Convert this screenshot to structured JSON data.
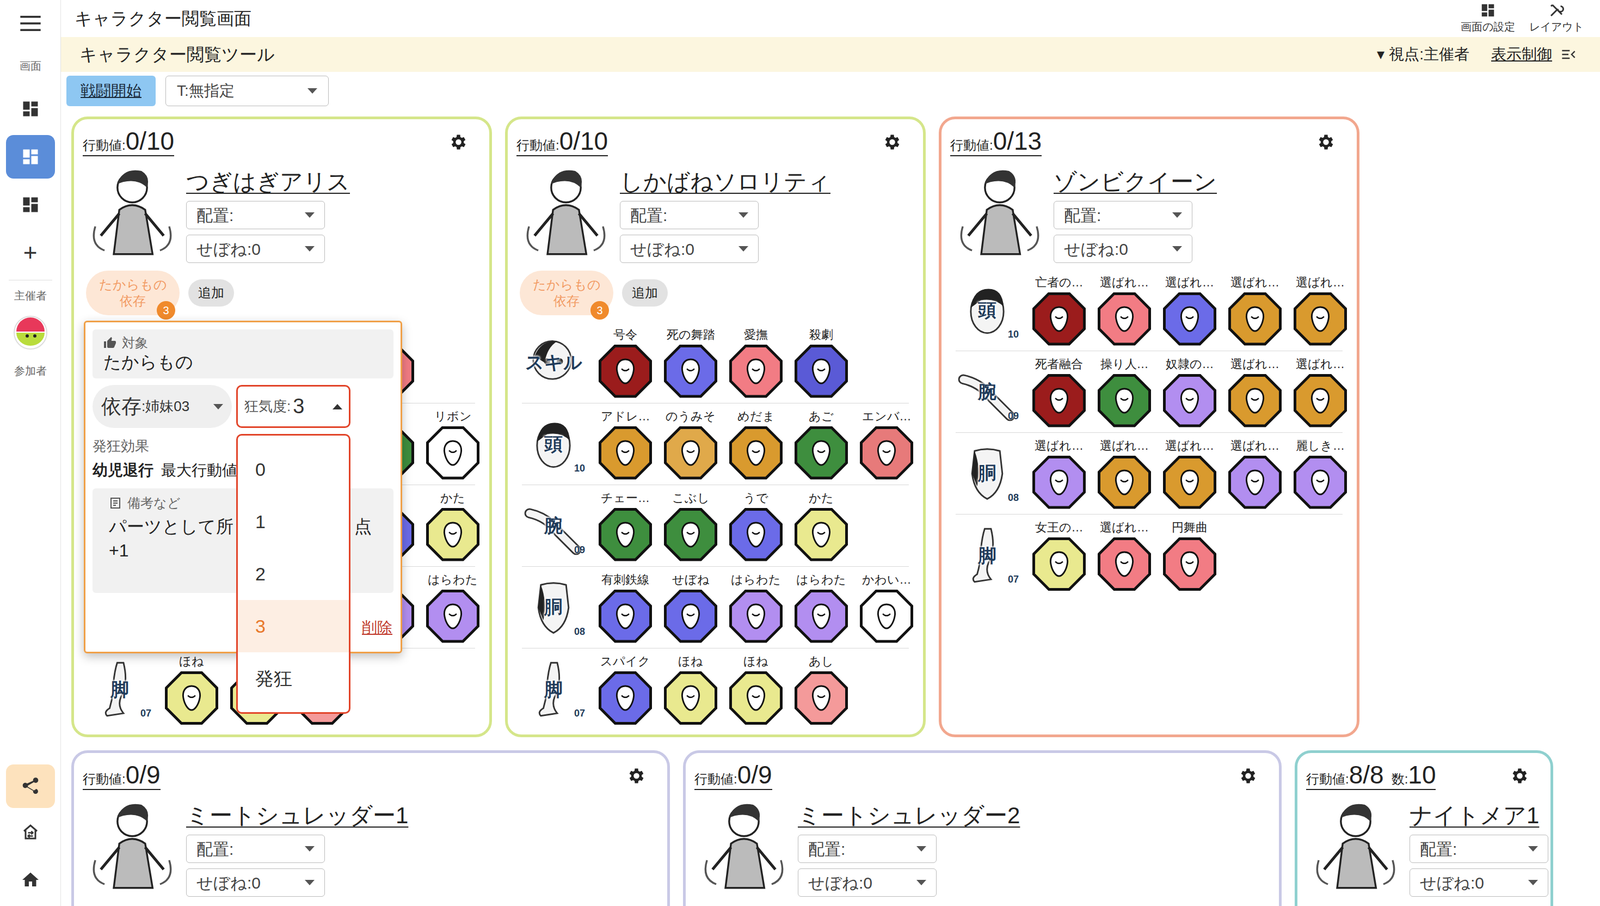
{
  "header": {
    "title": "キャラクター閲覧画面",
    "actions": [
      {
        "label": "画面の設定"
      },
      {
        "label": "レイアウト"
      }
    ]
  },
  "toolbar": {
    "title": "キャラクター閲覧ツール",
    "viewpoint": "▾ 視点:主催者",
    "display_control": "表示制御"
  },
  "controls": {
    "battle_button": "戦闘開始",
    "target_select": "T:無指定"
  },
  "sidebar": {
    "section_screens": "画面",
    "screens": [
      {
        "selected": false
      },
      {
        "selected": true
      },
      {
        "selected": false
      }
    ],
    "add": "+",
    "section_host": "主催者",
    "section_participants": "参加者"
  },
  "characters": [
    {
      "name": "つぎはぎアリス",
      "action_label": "行動値:",
      "action": "0/10",
      "placement": "配置:",
      "spine": "せぼね:0",
      "color": "#d5e68a",
      "badges": [
        {
          "lines": [
            "たからもの",
            "依存"
          ],
          "count": "3"
        }
      ],
      "add": "追加",
      "rows": [
        {
          "kind": "skill",
          "parts": [
            {
              "color": "#9b1c1c"
            },
            {
              "color": "#6b6be8"
            },
            {
              "color": "#f27c84"
            },
            {
              "color": "#f27c84"
            }
          ]
        },
        {
          "kind": "head",
          "parts": [
            {
              "color": "#d99a2e"
            },
            {
              "color": "#d99a2e"
            },
            {
              "color": "#d99a2e"
            },
            {
              "color": "#3e8e3e"
            },
            {
              "label": "リボン",
              "color": "#ffffff"
            }
          ]
        },
        {
          "kind": "arm",
          "parts": [
            {
              "color": "#3e8e3e"
            },
            {
              "color": "#3e8e3e"
            },
            {
              "color": "#6b6be8"
            },
            {
              "color": "#6b6be8"
            },
            {
              "label": "かた",
              "color": "#e9e98f"
            }
          ]
        },
        {
          "kind": "torso",
          "parts": [
            {
              "color": "#6b6be8"
            },
            {
              "color": "#6b6be8"
            },
            {
              "color": "#b28ef0"
            },
            {
              "color": "#b28ef0"
            },
            {
              "label": "はらわた",
              "color": "#b28ef0"
            }
          ]
        },
        {
          "kind": "leg",
          "category": "脚",
          "number": "07",
          "parts": [
            {
              "label": "ほね",
              "color": "#e9e98f"
            },
            {
              "color": "#e9e98f"
            },
            {
              "color": "#f49a9a"
            }
          ]
        }
      ],
      "popover": {
        "target_label": "対象",
        "target": "たからもの",
        "dependency_label": "依存",
        "dependency_value": ":姉妹03",
        "madness_label": "狂気度:",
        "madness_value": "3",
        "effect_label": "発狂効果",
        "effect_name": "幼児退行",
        "effect_text": "最大行動値",
        "note_label": "備考など",
        "note_start": "パーツとして所",
        "note_end": "点",
        "note_line2": "+1",
        "delete": "削除",
        "options": [
          {
            "label": "0",
            "selected": false
          },
          {
            "label": "1",
            "selected": false
          },
          {
            "label": "2",
            "selected": false
          },
          {
            "label": "3",
            "selected": true
          },
          {
            "label": "発狂",
            "selected": false
          }
        ]
      }
    },
    {
      "name": "しかばねソロリティ",
      "action_label": "行動値:",
      "action": "0/10",
      "placement": "配置:",
      "spine": "せぼね:0",
      "color": "#d5e68a",
      "badges": [
        {
          "lines": [
            "たからもの",
            "依存"
          ],
          "count": "3"
        }
      ],
      "add": "追加",
      "rows": [
        {
          "kind": "skill",
          "category": "スキル",
          "parts": [
            {
              "label": "号令",
              "color": "#9b1c1c"
            },
            {
              "label": "死の舞踏",
              "color": "#6b6be8"
            },
            {
              "label": "愛撫",
              "color": "#f27c84"
            },
            {
              "label": "殺劇",
              "color": "#5a5ad6"
            }
          ]
        },
        {
          "kind": "head",
          "category": "頭",
          "number": "10",
          "parts": [
            {
              "label": "アドレ…",
              "color": "#d99a2e"
            },
            {
              "label": "のうみそ",
              "color": "#e0a94a"
            },
            {
              "label": "めだま",
              "color": "#d99a2e"
            },
            {
              "label": "あご",
              "color": "#3e8e3e"
            },
            {
              "label": "エンバ…",
              "color": "#e77a7a"
            }
          ]
        },
        {
          "kind": "arm",
          "category": "腕",
          "number": "09",
          "parts": [
            {
              "label": "チェー…",
              "color": "#3e8e3e"
            },
            {
              "label": "こぶし",
              "color": "#3e8e3e"
            },
            {
              "label": "うで",
              "color": "#6b6be8"
            },
            {
              "label": "かた",
              "color": "#e9e98f"
            }
          ]
        },
        {
          "kind": "torso",
          "category": "胴",
          "number": "08",
          "parts": [
            {
              "label": "有刺鉄線",
              "color": "#6b6be8"
            },
            {
              "label": "せぼね",
              "color": "#6b6be8"
            },
            {
              "label": "はらわた",
              "color": "#b28ef0"
            },
            {
              "label": "はらわた",
              "color": "#b28ef0"
            },
            {
              "label": "かわい…",
              "color": "#ffffff"
            }
          ]
        },
        {
          "kind": "leg",
          "category": "脚",
          "number": "07",
          "parts": [
            {
              "label": "スパイク",
              "color": "#6b6be8"
            },
            {
              "label": "ほね",
              "color": "#e9e98f"
            },
            {
              "label": "ほね",
              "color": "#e9e98f"
            },
            {
              "label": "あし",
              "color": "#f49a9a"
            }
          ]
        }
      ]
    },
    {
      "name": "ゾンビクイーン",
      "action_label": "行動値:",
      "action": "0/13",
      "placement": "配置:",
      "spine": "せぼね:0",
      "color": "#f2a78e",
      "rows": [
        {
          "kind": "head",
          "category": "頭",
          "number": "10",
          "parts": [
            {
              "label": "亡者の…",
              "color": "#9b1c1c"
            },
            {
              "label": "選ばれ…",
              "color": "#f27c84"
            },
            {
              "label": "選ばれ…",
              "color": "#6b6be8"
            },
            {
              "label": "選ばれ…",
              "color": "#d99a2e"
            },
            {
              "label": "選ばれ…",
              "color": "#d99a2e"
            }
          ]
        },
        {
          "kind": "arm",
          "category": "腕",
          "number": "09",
          "parts": [
            {
              "label": "死者融合",
              "color": "#9b1c1c"
            },
            {
              "label": "操り人…",
              "color": "#3e8e3e"
            },
            {
              "label": "奴隷の…",
              "color": "#b28ef0"
            },
            {
              "label": "選ばれ…",
              "color": "#d99a2e"
            },
            {
              "label": "選ばれ…",
              "color": "#d99a2e"
            }
          ]
        },
        {
          "kind": "torso",
          "category": "胴",
          "number": "08",
          "parts": [
            {
              "label": "選ばれ…",
              "color": "#b28ef0"
            },
            {
              "label": "選ばれ…",
              "color": "#d99a2e"
            },
            {
              "label": "選ばれ…",
              "color": "#d99a2e"
            },
            {
              "label": "選ばれ…",
              "color": "#b28ef0"
            },
            {
              "label": "麗しき…",
              "color": "#b28ef0"
            }
          ]
        },
        {
          "kind": "leg",
          "category": "脚",
          "number": "07",
          "parts": [
            {
              "label": "女王の…",
              "color": "#e9e98f"
            },
            {
              "label": "選ばれ…",
              "color": "#f27c84"
            },
            {
              "label": "円舞曲",
              "color": "#f27c84"
            }
          ]
        }
      ]
    },
    {
      "name": "ミートシュレッダー1",
      "action_label": "行動値:",
      "action": "0/9",
      "placement": "配置:",
      "spine": "せぼね:0",
      "color": "#c9c9e6",
      "rows": []
    },
    {
      "name": "ミートシュレッダー2",
      "action_label": "行動値:",
      "action": "0/9",
      "placement": "配置:",
      "spine": "せぼね:0",
      "color": "#c9c9e6",
      "rows": []
    },
    {
      "name": "ナイトメア1",
      "action_label": "行動値:",
      "action": "8/8",
      "count_label": "数:",
      "count": "10",
      "placement": "配置:",
      "spine": "せぼね:0",
      "color": "#8fd0cf",
      "rows": []
    }
  ]
}
